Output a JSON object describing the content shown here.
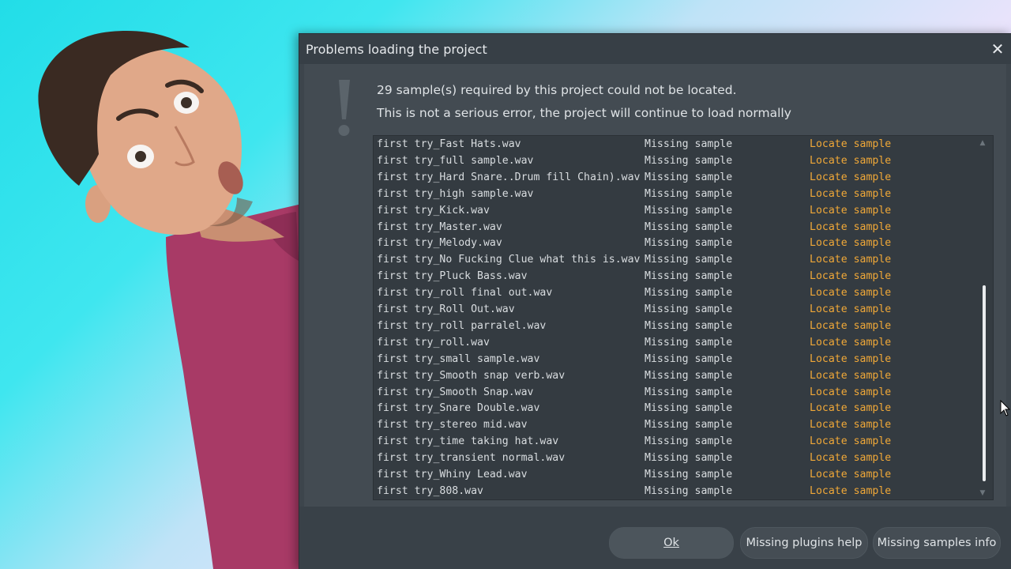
{
  "dialog": {
    "title": "Problems loading the project",
    "message_line1": "29 sample(s) required by this project could not be located.",
    "message_line2": "This is not a serious error, the project will continue to load normally"
  },
  "samples": [
    {
      "file": "first try_Fast Hats.wav",
      "status": "Missing sample",
      "action": "Locate sample"
    },
    {
      "file": "first try_full sample.wav",
      "status": "Missing sample",
      "action": "Locate sample"
    },
    {
      "file": "first try_Hard Snare..Drum fill Chain).wav",
      "status": "Missing sample",
      "action": "Locate sample"
    },
    {
      "file": "first try_high sample.wav",
      "status": "Missing sample",
      "action": "Locate sample"
    },
    {
      "file": "first try_Kick.wav",
      "status": "Missing sample",
      "action": "Locate sample"
    },
    {
      "file": "first try_Master.wav",
      "status": "Missing sample",
      "action": "Locate sample"
    },
    {
      "file": "first try_Melody.wav",
      "status": "Missing sample",
      "action": "Locate sample"
    },
    {
      "file": "first try_No Fucking Clue what this is.wav",
      "status": "Missing sample",
      "action": "Locate sample"
    },
    {
      "file": "first try_Pluck Bass.wav",
      "status": "Missing sample",
      "action": "Locate sample"
    },
    {
      "file": "first try_roll final out.wav",
      "status": "Missing sample",
      "action": "Locate sample"
    },
    {
      "file": "first try_Roll Out.wav",
      "status": "Missing sample",
      "action": "Locate sample"
    },
    {
      "file": "first try_roll parralel.wav",
      "status": "Missing sample",
      "action": "Locate sample"
    },
    {
      "file": "first try_roll.wav",
      "status": "Missing sample",
      "action": "Locate sample"
    },
    {
      "file": "first try_small sample.wav",
      "status": "Missing sample",
      "action": "Locate sample"
    },
    {
      "file": "first try_Smooth snap verb.wav",
      "status": "Missing sample",
      "action": "Locate sample"
    },
    {
      "file": "first try_Smooth Snap.wav",
      "status": "Missing sample",
      "action": "Locate sample"
    },
    {
      "file": "first try_Snare Double.wav",
      "status": "Missing sample",
      "action": "Locate sample"
    },
    {
      "file": "first try_stereo mid.wav",
      "status": "Missing sample",
      "action": "Locate sample"
    },
    {
      "file": "first try_time taking hat.wav",
      "status": "Missing sample",
      "action": "Locate sample"
    },
    {
      "file": "first try_transient normal.wav",
      "status": "Missing sample",
      "action": "Locate sample"
    },
    {
      "file": "first try_Whiny Lead.wav",
      "status": "Missing sample",
      "action": "Locate sample"
    },
    {
      "file": "first try_808.wav",
      "status": "Missing sample",
      "action": "Locate sample"
    }
  ],
  "buttons": {
    "ok": "Ok",
    "plugins_help": "Missing plugins help",
    "samples_info": "Missing samples info"
  },
  "colors": {
    "accent_locate": "#f0a838",
    "dialog_bg": "#3d454c",
    "list_bg": "#343b41"
  },
  "icons": {
    "close": "close-icon",
    "warning": "exclamation-icon"
  }
}
